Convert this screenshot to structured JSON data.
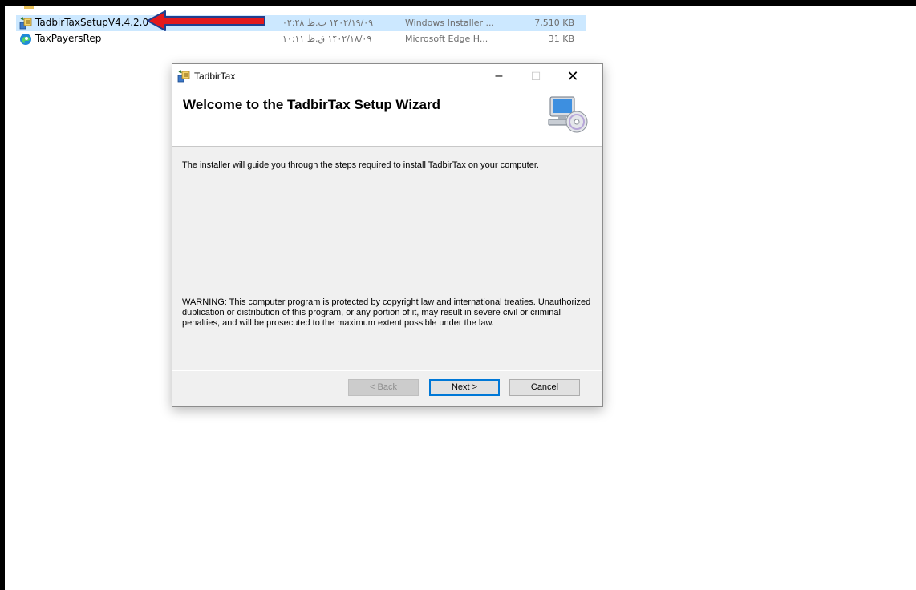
{
  "explorer": {
    "files": [
      {
        "name": "TadbirTaxSetupV4.4.2.0",
        "date": "۱۴۰۲/۱۹/۰۹ ب.ظ ۰۲:۲۸",
        "type": "Windows Installer ...",
        "size": "7,510 KB",
        "icon": "installer-icon",
        "selected": true
      },
      {
        "name": "TaxPayersRep",
        "date": "۱۴۰۲/۱۸/۰۹ ق.ظ ۱۰:۱۱",
        "type": "Microsoft Edge H...",
        "size": "31 KB",
        "icon": "edge-icon",
        "selected": false
      }
    ]
  },
  "annotation": {
    "arrow_color": "#e3191c"
  },
  "dialog": {
    "title": "TadbirTax",
    "heading": "Welcome to the TadbirTax Setup Wizard",
    "intro": "The installer will guide you through the steps required to install TadbirTax on your computer.",
    "warning": "WARNING: This computer program is protected by copyright law and international treaties. Unauthorized duplication or distribution of this program, or any portion of it, may result in severe civil or criminal penalties, and will be prosecuted to the maximum extent possible under the law.",
    "buttons": {
      "back": "< Back",
      "next": "Next >",
      "cancel": "Cancel"
    },
    "window_controls": {
      "minimize": "–",
      "maximize": "☐",
      "close": "✕"
    },
    "icons": {
      "title": "installer-icon",
      "banner": "computer-cd-icon"
    }
  }
}
